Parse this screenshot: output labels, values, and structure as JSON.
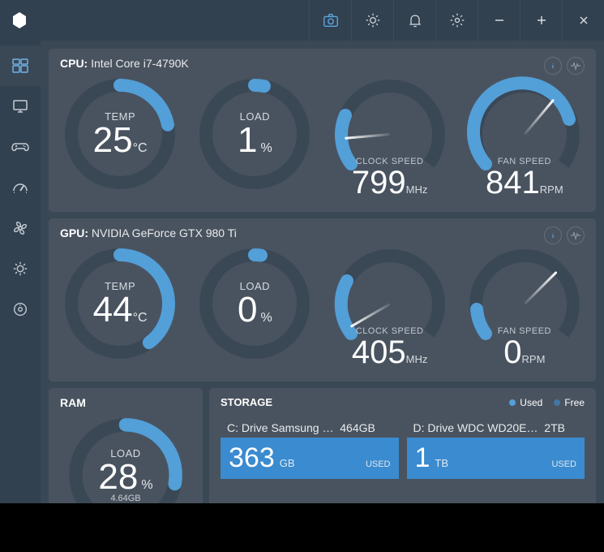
{
  "cpu": {
    "prefix": "CPU:",
    "name": "Intel Core i7-4790K",
    "temp_label": "TEMP",
    "temp_value": "25",
    "temp_unit": "°C",
    "temp_pct": 22,
    "load_label": "LOAD",
    "load_value": "1",
    "load_unit": "%",
    "load_pct": 1,
    "clock_label": "CLOCK SPEED",
    "clock_value": "799",
    "clock_unit": "MHz",
    "clock_angle": 175,
    "fan_label": "FAN SPEED",
    "fan_value": "841",
    "fan_unit": "RPM",
    "fan_angle": -50
  },
  "gpu": {
    "prefix": "GPU:",
    "name": "NVIDIA GeForce GTX 980 Ti",
    "temp_label": "TEMP",
    "temp_value": "44",
    "temp_unit": "°C",
    "temp_pct": 40,
    "load_label": "LOAD",
    "load_value": "0",
    "load_unit": "%",
    "load_pct": 0,
    "clock_label": "CLOCK SPEED",
    "clock_value": "405",
    "clock_unit": "MHz",
    "clock_angle": 150,
    "fan_label": "FAN SPEED",
    "fan_value": "0",
    "fan_unit": "RPM",
    "fan_angle": -45
  },
  "ram": {
    "title": "RAM",
    "load_label": "LOAD",
    "load_value": "28",
    "load_unit": "%",
    "load_pct": 28,
    "sub": "4.64GB"
  },
  "storage": {
    "title": "STORAGE",
    "legend_used": "Used",
    "legend_free": "Free",
    "drives": {
      "d0": {
        "name": "C: Drive Samsung …",
        "cap": "464GB",
        "used_val": "363",
        "used_unit": "GB",
        "tag": "USED"
      },
      "d1": {
        "name": "D: Drive WDC WD20E…",
        "cap": "2TB",
        "used_val": "1",
        "used_unit": "TB",
        "tag": "USED"
      }
    }
  }
}
